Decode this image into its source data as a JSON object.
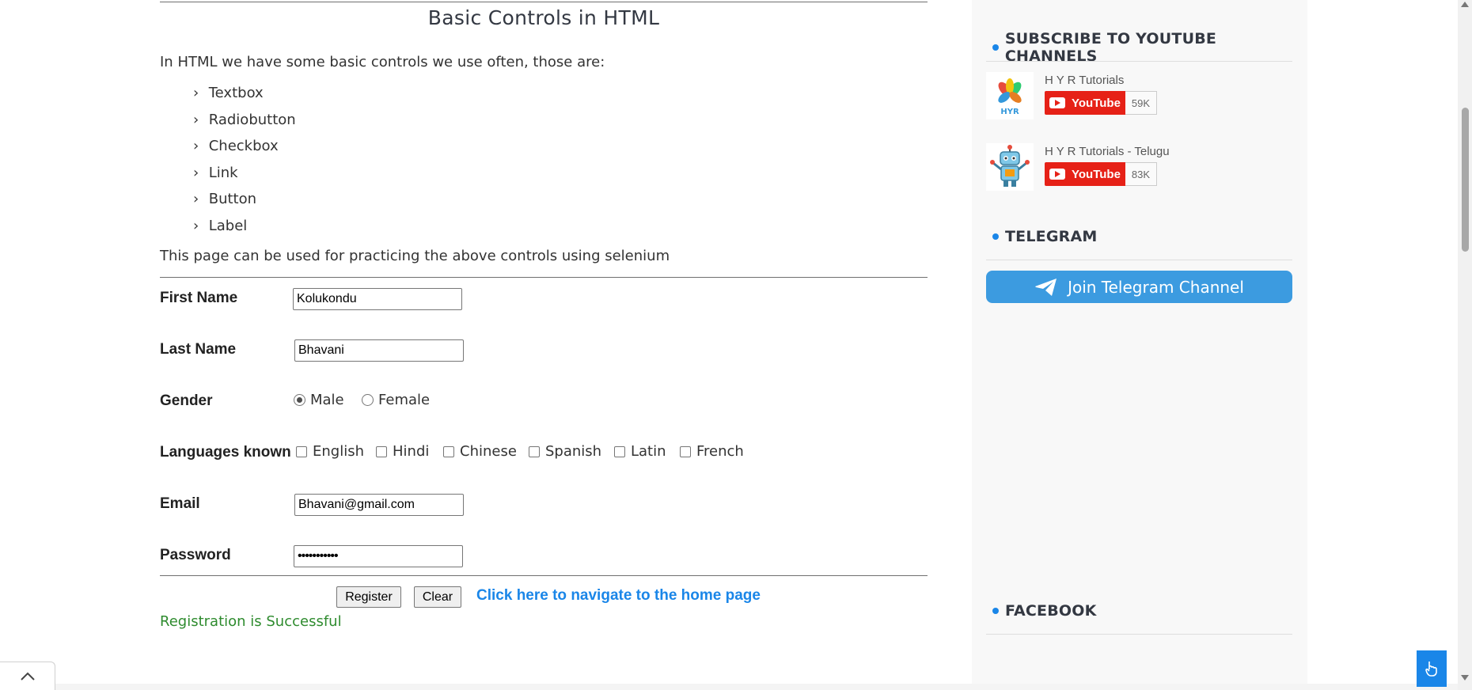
{
  "main": {
    "title": "Basic Controls in HTML",
    "intro": "In HTML we have some basic controls we use often, those are:",
    "controls": [
      {
        "label": "Textbox"
      },
      {
        "label": "Radiobutton"
      },
      {
        "label": "Checkbox"
      },
      {
        "label": "Link"
      },
      {
        "label": "Button"
      },
      {
        "label": "Label"
      }
    ],
    "practice_text": "This page can be used for practicing the above controls using selenium"
  },
  "form": {
    "first_name": {
      "label": "First Name",
      "value": "Kolukondu"
    },
    "last_name": {
      "label": "Last Name",
      "value": "Bhavani"
    },
    "gender": {
      "label": "Gender",
      "options": [
        "Male",
        "Female"
      ],
      "selected": "Male"
    },
    "languages": {
      "label": "Languages known",
      "options": [
        "English",
        "Hindi",
        "Chinese",
        "Spanish",
        "Latin",
        "French"
      ]
    },
    "email": {
      "label": "Email",
      "value": "Bhavani@gmail.com"
    },
    "password": {
      "label": "Password",
      "value": "•••••••••••"
    },
    "register_label": "Register",
    "clear_label": "Clear",
    "home_link": "Click here to navigate to the home page",
    "status": "Registration is Successful"
  },
  "sidebar": {
    "youtube_heading": "SUBSCRIBE TO YOUTUBE CHANNELS",
    "channels": [
      {
        "name": "H Y R Tutorials",
        "button": "YouTube",
        "count": "59K",
        "logo_text": "HYR"
      },
      {
        "name": "H Y R Tutorials - Telugu",
        "button": "YouTube",
        "count": "83K"
      }
    ],
    "telegram_heading": "TELEGRAM",
    "telegram_button": "Join Telegram Channel",
    "facebook_heading": "FACEBOOK"
  },
  "colors": {
    "accent": "#1a86e8",
    "youtube_red": "#e62117",
    "telegram_blue": "#3c9be0",
    "success_green": "#2e8b2e",
    "sidebar_bg": "#f8f8f8"
  },
  "icons": {
    "back_to_top": "chevron-up-icon",
    "floating": "hand-pointer-icon",
    "telegram": "paper-plane-icon"
  }
}
